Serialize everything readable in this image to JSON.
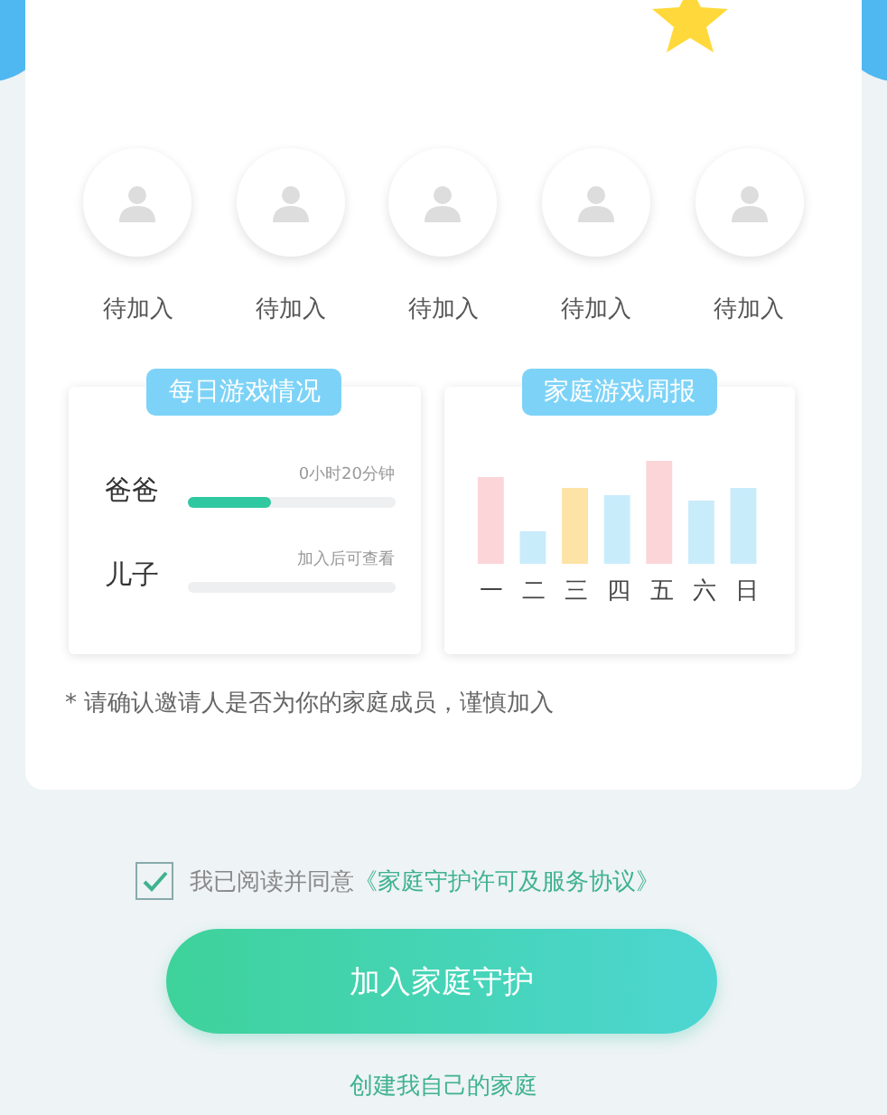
{
  "members": [
    {
      "label": "待加入"
    },
    {
      "label": "待加入"
    },
    {
      "label": "待加入"
    },
    {
      "label": "待加入"
    },
    {
      "label": "待加入"
    }
  ],
  "daily": {
    "title": "每日游戏情况",
    "rows": [
      {
        "name": "爸爸",
        "reading": "0小时20分钟",
        "level": 0.4
      },
      {
        "name": "儿子",
        "reading": "加入后可查看"
      }
    ]
  },
  "weekly": {
    "title": "家庭游戏周报",
    "days": [
      "一",
      "二",
      "三",
      "四",
      "五",
      "六",
      "日"
    ]
  },
  "note": "* 请确认邀请人是否为你的家庭成员，谨慎加入",
  "agreement": {
    "checked": true,
    "text": "我已阅读并同意",
    "link": "《家庭守护许可及服务协议》"
  },
  "join_button": "加入家庭守护",
  "create_link": "创建我自己的家庭"
}
